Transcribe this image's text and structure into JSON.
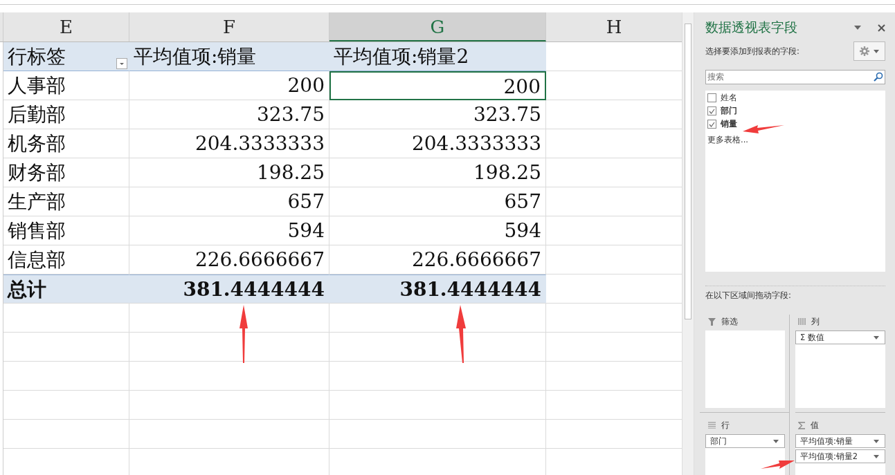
{
  "sheet": {
    "columns": [
      {
        "label": "E",
        "selected": false
      },
      {
        "label": "F",
        "selected": false
      },
      {
        "label": "G",
        "selected": true
      },
      {
        "label": "H",
        "selected": false
      }
    ],
    "pivot": {
      "header": {
        "row_label": "行标签",
        "measure_1": "平均值项:销量",
        "measure_2": "平均值项:销量2"
      },
      "rows": [
        {
          "label": "人事部",
          "value_1": "200",
          "value_2": "200",
          "selected": true
        },
        {
          "label": "后勤部",
          "value_1": "323.75",
          "value_2": "323.75",
          "selected": false
        },
        {
          "label": "机务部",
          "value_1": "204.3333333",
          "value_2": "204.3333333",
          "selected": false
        },
        {
          "label": "财务部",
          "value_1": "198.25",
          "value_2": "198.25",
          "selected": false
        },
        {
          "label": "生产部",
          "value_1": "657",
          "value_2": "657",
          "selected": false
        },
        {
          "label": "销售部",
          "value_1": "594",
          "value_2": "594",
          "selected": false
        },
        {
          "label": "信息部",
          "value_1": "226.6666667",
          "value_2": "226.6666667",
          "selected": false
        }
      ],
      "total": {
        "label": "总计",
        "value_1": "381.4444444",
        "value_2": "381.4444444"
      }
    }
  },
  "field_pane": {
    "title": "数据透视表字段",
    "subtitle": "选择要添加到报表的字段:",
    "search": {
      "placeholder": "搜索"
    },
    "fields": [
      {
        "label": "姓名",
        "checked": false
      },
      {
        "label": "部门",
        "checked": true
      },
      {
        "label": "销量",
        "checked": true
      }
    ],
    "more_tables": "更多表格...",
    "areas_label": "在以下区域间拖动字段:",
    "areas": [
      {
        "kind": "filter",
        "title": "筛选"
      },
      {
        "kind": "columns",
        "title": "列",
        "items": [
          "Σ 数值"
        ]
      },
      {
        "kind": "rows",
        "title": "行",
        "items": [
          "部门"
        ]
      },
      {
        "kind": "values",
        "title": "值",
        "items": [
          "平均值项:销量",
          "平均值项:销量2"
        ]
      }
    ]
  }
}
